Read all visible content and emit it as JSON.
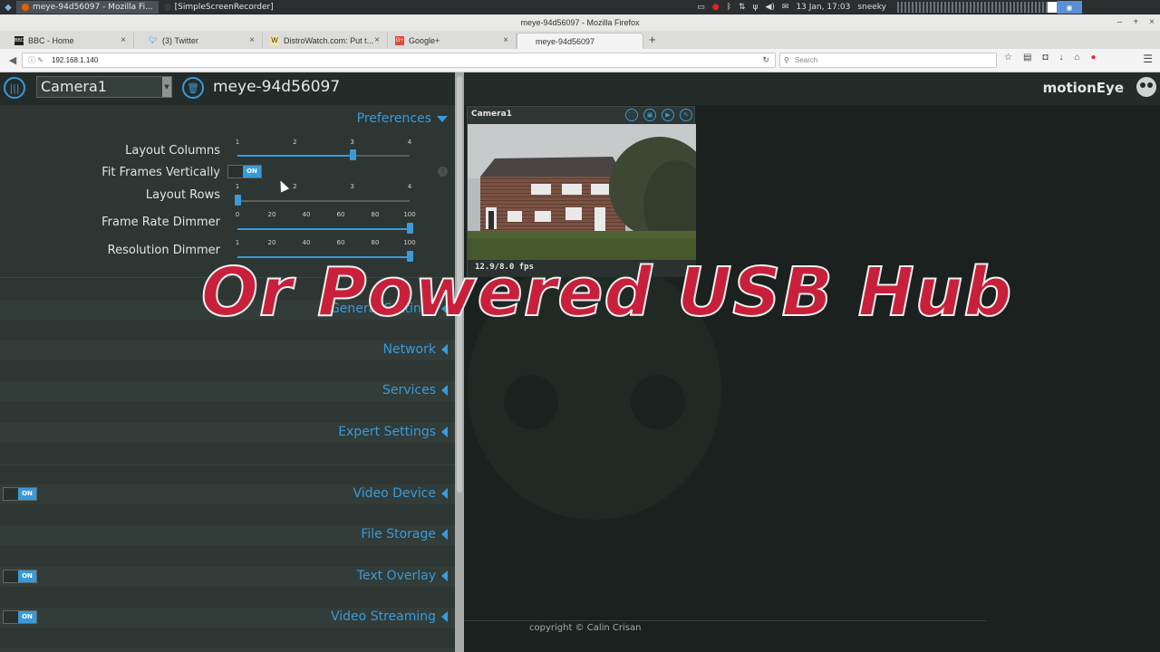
{
  "taskbar": {
    "tasks": [
      {
        "label": "meye-94d56097 - Mozilla Fi...",
        "active": true
      },
      {
        "label": "[SimpleScreenRecorder]",
        "active": false
      }
    ],
    "clock": "13 Jan, 17:03",
    "user": "sneeky"
  },
  "browser": {
    "window_title": "meye-94d56097 - Mozilla Firefox",
    "tabs": [
      {
        "label": "BBC - Home",
        "icon": "BBC"
      },
      {
        "label": "(3) Twitter",
        "icon": "twitter-icon"
      },
      {
        "label": "DistroWatch.com: Put t...",
        "icon": "W"
      },
      {
        "label": "Google+",
        "icon": "G+"
      },
      {
        "label": "meye-94d56097",
        "icon": ""
      }
    ],
    "url": "192.168.1.140",
    "search_placeholder": "Search"
  },
  "app": {
    "camera_select": "Camera1",
    "camera_host": "meye-94d56097",
    "brand": "motionEye",
    "accent": "#3a9ad9",
    "preferences": {
      "title": "Preferences",
      "rows": [
        {
          "label": "Layout Columns",
          "ticks": [
            "1",
            "2",
            "3",
            "4"
          ],
          "value": 3,
          "min": 1,
          "max": 4
        },
        {
          "label": "Fit Frames Vertically",
          "toggle": "ON"
        },
        {
          "label": "Layout Rows",
          "ticks": [
            "1",
            "2",
            "3",
            "4"
          ],
          "value": 1,
          "min": 1,
          "max": 4
        },
        {
          "label": "Frame Rate Dimmer",
          "ticks": [
            "0",
            "20",
            "40",
            "60",
            "80",
            "100"
          ],
          "value": 100,
          "min": 0,
          "max": 100
        },
        {
          "label": "Resolution Dimmer",
          "ticks": [
            "1",
            "20",
            "40",
            "60",
            "80",
            "100"
          ],
          "value": 100,
          "min": 1,
          "max": 100
        }
      ]
    },
    "sections": [
      {
        "label": "General Settings",
        "toggle": null
      },
      {
        "label": "Network",
        "toggle": null
      },
      {
        "label": "Services",
        "toggle": null
      },
      {
        "label": "Expert Settings",
        "toggle": null
      },
      {
        "label": "Video Device",
        "toggle": "ON"
      },
      {
        "label": "File Storage",
        "toggle": null
      },
      {
        "label": "Text Overlay",
        "toggle": "ON"
      },
      {
        "label": "Video Streaming",
        "toggle": "ON"
      }
    ],
    "camera_frame": {
      "title": "Camera1",
      "fps": "12.9/8.0 fps"
    },
    "copyright": "copyright © Calin Crisan"
  },
  "overlay_caption": "Or Powered USB Hub"
}
